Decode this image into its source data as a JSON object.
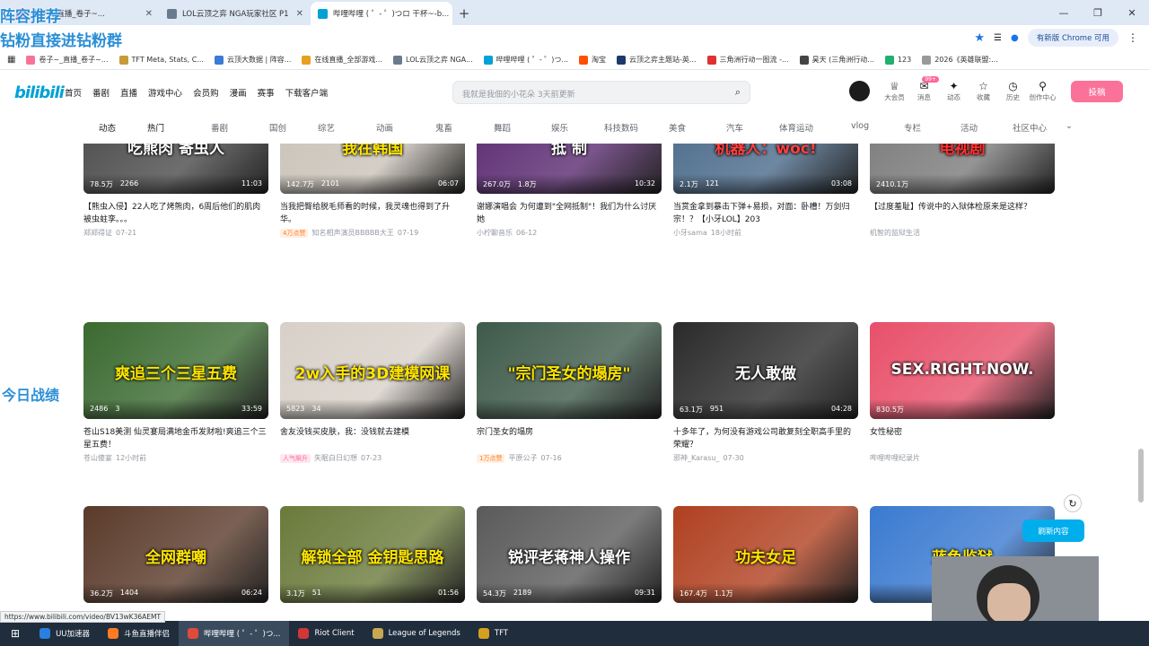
{
  "overlay": {
    "line1": "阵容推荐",
    "line2": "钻粉直接进钻粉群",
    "side": "今日战绩"
  },
  "browser": {
    "tabs": [
      {
        "label": "卷子~_直播_卷子~...",
        "color": "#fb7299"
      },
      {
        "label": "LOL云顶之弈 NGA玩家社区 P1",
        "color": "#6b7b8c"
      },
      {
        "label": "哔哩哔哩 ( ゜- ゜)つロ 干杯~-b...",
        "color": "#00a1d6"
      }
    ],
    "update_label": "有新版 Chrome 可用",
    "bookmarks": [
      {
        "label": "卷子~_直播_卷子~...",
        "color": "#fb7299"
      },
      {
        "label": "TFT Meta, Stats, C...",
        "color": "#c79a3a"
      },
      {
        "label": "云顶大数据 | 阵容...",
        "color": "#3a7bd5"
      },
      {
        "label": "在线直播_全部游戏...",
        "color": "#e8a020"
      },
      {
        "label": "LOL云顶之弈 NGA...",
        "color": "#6b7b8c"
      },
      {
        "label": "哔哩哔哩 ( ゜- ゜)つ...",
        "color": "#00a1d6"
      },
      {
        "label": "淘宝",
        "color": "#ff5000"
      },
      {
        "label": "云顶之弈主题站-英...",
        "color": "#1b3a6b"
      },
      {
        "label": "三角洲行动一图流 -...",
        "color": "#e03030"
      },
      {
        "label": "昊天 (三角洲行动...",
        "color": "#444444"
      },
      {
        "label": "123",
        "color": "#20b070"
      },
      {
        "label": "2026《英雄联盟:...",
        "color": "#999999"
      }
    ]
  },
  "bili": {
    "logo": "bilibili",
    "nav": [
      "首页",
      "番剧",
      "直播",
      "游戏中心",
      "会员购",
      "漫画",
      "赛事",
      "下载客户端"
    ],
    "search_placeholder": "我就是我佃的小花朵 3天前更新",
    "user_icons": [
      "大会员",
      "消息",
      "动态",
      "收藏",
      "历史",
      "创作中心"
    ],
    "msg_badge": "99+",
    "upload": "投稿",
    "channels": [
      "动态",
      "热门",
      "番剧",
      "国创",
      "综艺",
      "动画",
      "鬼畜",
      "舞蹈",
      "娱乐",
      "科技数码",
      "美食",
      "汽车",
      "体育运动",
      "vlog",
      "专栏",
      "活动",
      "社区中心"
    ],
    "refresh": "刷新内容"
  },
  "videos": [
    {
      "views": "78.5万",
      "danmaku": "2266",
      "dur": "11:03",
      "title": "【熊虫入侵】22人吃了烤熊肉，6周后他们的肌肉被虫蛀孪。。。",
      "author": "郑郑得证",
      "date": "07-21",
      "tag": "",
      "thumbtext": "吃熊肉 寄虫人",
      "bg": "#4a4a4a",
      "fg": "#ffffff"
    },
    {
      "views": "142.7万",
      "danmaku": "2101",
      "dur": "06:07",
      "title": "当我把臀给脱毛师看的时候，我灵魂也得到了升华。",
      "author": "知名相声演员BBBBB大王",
      "date": "07-19",
      "tag": "4万点赞",
      "thumbtext": "我在韩国",
      "bg": "#c9c2b8",
      "fg": "#ffe600"
    },
    {
      "views": "267.0万",
      "danmaku": "1.8万",
      "dur": "10:32",
      "title": "谢娜演唱会 为何遭到\"全网抵制\"！我们为什么讨厌她",
      "author": "小柠聊音乐",
      "date": "06-12",
      "tag": "",
      "thumbtext": "抵   制",
      "bg": "#5a2a70",
      "fg": "#ffffff"
    },
    {
      "views": "2.1万",
      "danmaku": "121",
      "dur": "03:08",
      "title": "当赏金拿到暴击下弹+易损，对面：卧槽！万剑归宗！？【小牙LOL】203",
      "author": "小牙sama",
      "date": "18小时前",
      "tag": "",
      "thumbtext": "机器人：woc!",
      "bg": "#4a6a8a",
      "fg": "#ff4040"
    },
    {
      "views": "2410.1万",
      "danmaku": "",
      "dur": "",
      "title": "【过度羞耻】传说中的入狱体检原来是这样？",
      "author": "机智的监狱生活",
      "date": "",
      "tag": "",
      "thumbtext": "电视剧",
      "bg": "#7a7a7a",
      "fg": "#ff3030"
    },
    {
      "views": "2486",
      "danmaku": "3",
      "dur": "33:59",
      "title": "苍山S18美测 仙灵宴局满地金币发财啦!爽追三个三星五费！",
      "author": "苍山傻宴",
      "date": "12小时前",
      "tag": "",
      "thumbtext": "爽追三个三星五费",
      "bg": "#3a6a30",
      "fg": "#ffe600"
    },
    {
      "views": "5823",
      "danmaku": "34",
      "dur": "",
      "title": "舍友没钱买皮肤，我：没钱就去建模",
      "author": "失眠白日幻想",
      "date": "07-23",
      "tag": "人气飙升",
      "thumbtext": "2w入手的3D建模网课",
      "bg": "#d8d0c8",
      "fg": "#ffe600"
    },
    {
      "views": "",
      "danmaku": "",
      "dur": "",
      "title": "宗门圣女的塌房",
      "author": "平原公子",
      "date": "07-16",
      "tag": "1万点赞",
      "thumbtext": "\"宗门圣女的塌房\"",
      "bg": "#3e5a4a",
      "fg": "#ffe600"
    },
    {
      "views": "63.1万",
      "danmaku": "951",
      "dur": "04:28",
      "title": "十多年了，为何没有游戏公司敢复刻全职高手里的荣耀？",
      "author": "邪神_Karasu_",
      "date": "07-30",
      "tag": "",
      "thumbtext": "无人敢做",
      "bg": "#2a2a2a",
      "fg": "#ffffff"
    },
    {
      "views": "830.5万",
      "danmaku": "",
      "dur": "",
      "title": "女性秘密",
      "author": "哔哩哔哩纪录片",
      "date": "",
      "tag": "",
      "thumbtext": "SEX.RIGHT.NOW.",
      "bg": "#e8506a",
      "fg": "#ffffff"
    },
    {
      "views": "36.2万",
      "danmaku": "1404",
      "dur": "06:24",
      "title": "",
      "author": "",
      "date": "",
      "tag": "",
      "thumbtext": "全网群嘲",
      "bg": "#5a3a2a",
      "fg": "#ffe600"
    },
    {
      "views": "3.1万",
      "danmaku": "51",
      "dur": "01:56",
      "title": "",
      "author": "",
      "date": "",
      "tag": "",
      "thumbtext": "解锁全部 金钥匙思路",
      "bg": "#6a7a3a",
      "fg": "#ffe600"
    },
    {
      "views": "54.3万",
      "danmaku": "2189",
      "dur": "09:31",
      "title": "",
      "author": "",
      "date": "",
      "tag": "",
      "thumbtext": "锐评老蒋神人操作",
      "bg": "#5a5a5a",
      "fg": "#ffffff"
    },
    {
      "views": "167.4万",
      "danmaku": "1.1万",
      "dur": "",
      "title": "",
      "author": "",
      "date": "",
      "tag": "",
      "thumbtext": "功夫女足",
      "bg": "#b04020",
      "fg": "#ffe600"
    },
    {
      "views": "",
      "danmaku": "",
      "dur": "",
      "title": "",
      "author": "",
      "date": "",
      "tag": "",
      "thumbtext": "蓝色监狱",
      "bg": "#3a7ad0",
      "fg": "#ffe600"
    }
  ],
  "status_url": "https://www.bilibili.com/video/BV13wK36AEMT",
  "taskbar": [
    {
      "label": "UU加速器",
      "color": "#2a7fe0",
      "active": false
    },
    {
      "label": "斗鱼直播伴侣",
      "color": "#ff7a20",
      "active": false
    },
    {
      "label": "哔哩哔哩 ( ゜- ゜)つ...",
      "color": "#e04a3a",
      "active": true
    },
    {
      "label": "Riot Client",
      "color": "#d13639",
      "active": false
    },
    {
      "label": "League of Legends",
      "color": "#c8a850",
      "active": false
    },
    {
      "label": "TFT",
      "color": "#d4a020",
      "active": false
    }
  ]
}
